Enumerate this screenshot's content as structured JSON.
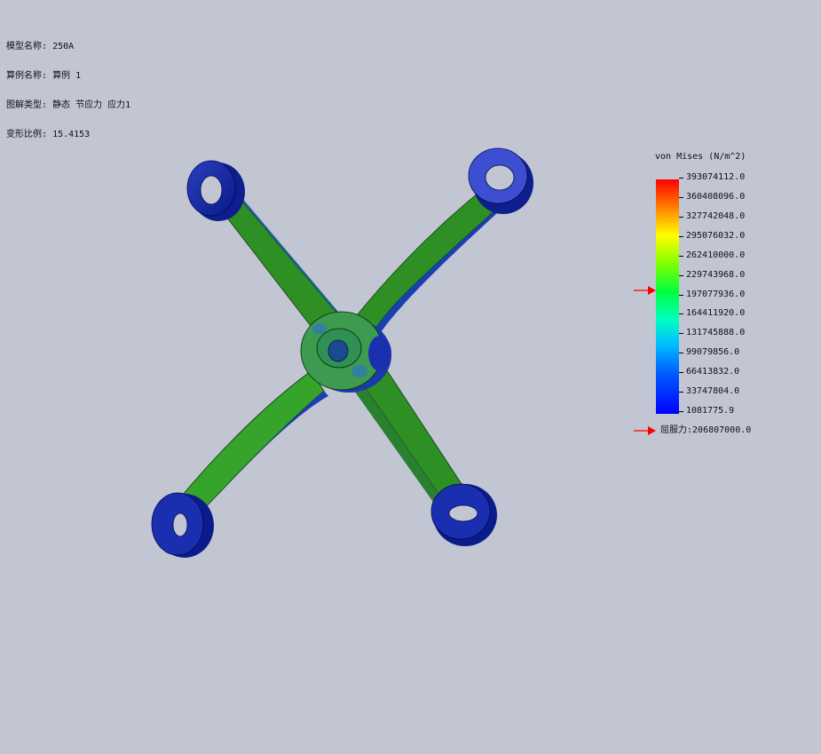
{
  "info": {
    "model_label": "模型名称:",
    "model_value": "250A",
    "study_label": "算例名称:",
    "study_value": "算例 1",
    "plot_type_label": "图解类型:",
    "plot_type_value": "静态 节应力 应力1",
    "deformation_label": "变形比例:",
    "deformation_value": "15.4153"
  },
  "legend": {
    "title": "von Mises (N/m^2)",
    "values": [
      "393074112.0",
      "360408096.0",
      "327742048.0",
      "295076032.0",
      "262410000.0",
      "229743968.0",
      "197077936.0",
      "164411920.0",
      "131745888.0",
      "99079856.0",
      "66413832.0",
      "33747804.0",
      "1081775.9"
    ],
    "yield_label": "屈服力:",
    "yield_value": "206807000.0",
    "colors": {
      "max": "#ff0000",
      "mid": "#00ff40",
      "min": "#0000ff",
      "arrow": "#ff0000"
    }
  },
  "model": {
    "colors": {
      "arm": "#2e8b1e",
      "arm_light": "#3ba32a",
      "boss": "#0a1f9a",
      "edge": "#061060",
      "hub": "#3a9a4a"
    }
  }
}
